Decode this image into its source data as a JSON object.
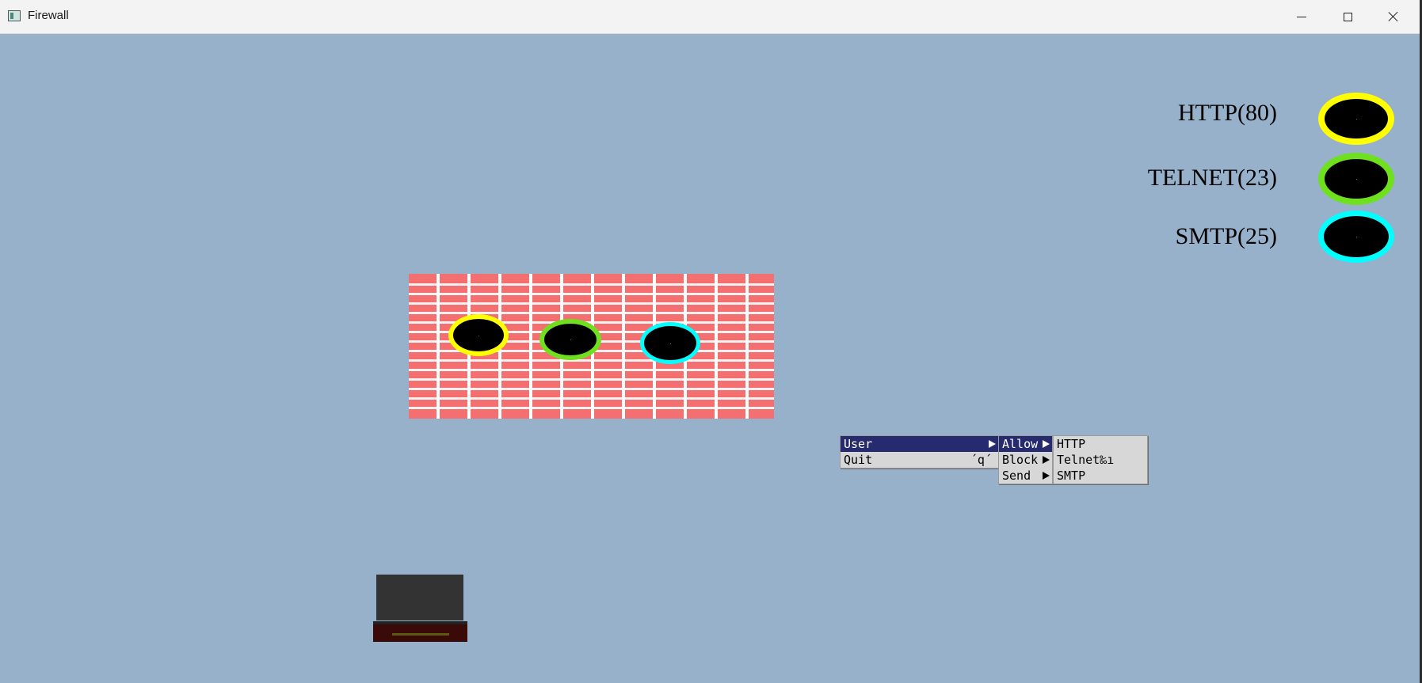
{
  "window": {
    "title": "Firewall"
  },
  "legend": [
    {
      "label": "HTTP(80)",
      "color": "#ffff00"
    },
    {
      "label": "TELNET(23)",
      "color": "#6ee01e"
    },
    {
      "label": "SMTP(25)",
      "color": "#00ffff"
    }
  ],
  "wall_ports": [
    {
      "color": "#ffff00"
    },
    {
      "color": "#6ee01e"
    },
    {
      "color": "#00ffff"
    }
  ],
  "menu": {
    "main": [
      {
        "label": "User",
        "selected": true,
        "submenu": true
      },
      {
        "label": "Quit",
        "accel": "´q´"
      }
    ],
    "user_submenu": [
      "Allow",
      "Block",
      "Send"
    ],
    "allow_submenu": [
      "HTTP",
      "Telnet‰ı",
      "SMTP"
    ]
  },
  "colors": {
    "background": "#98b1cb",
    "wall": "#f47070",
    "menu_highlight": "#262a6e"
  }
}
